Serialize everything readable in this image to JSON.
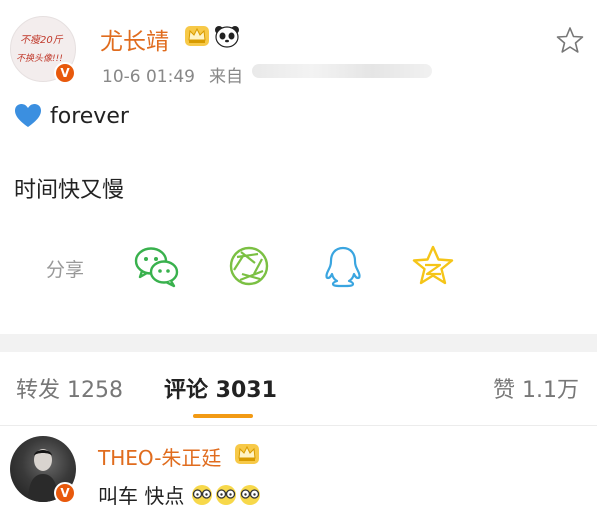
{
  "post": {
    "author": "尤长靖",
    "avatar_text_line1": "不瘦20斤",
    "avatar_text_line2": "不换头像!!!",
    "verified_badge": "V",
    "badges": [
      "crown-icon",
      "panda-icon"
    ],
    "time": "10-6 01:49",
    "source_prefix": "来自",
    "line1_emoji": "blue-heart-icon",
    "line1_text": "forever",
    "line2_text": "时间快又慢",
    "share_label": "分享",
    "share_targets": [
      "wechat-icon",
      "moments-icon",
      "qq-icon",
      "qzone-icon"
    ]
  },
  "tabs": {
    "repost": "转发 1258",
    "comment": "评论 3031",
    "like": "赞 1.1万"
  },
  "comment": {
    "author": "THEO-朱正廷",
    "verified_badge": "V",
    "badge": "crown-icon",
    "text": "叫车 快点",
    "emojis": [
      "glasses-face-icon",
      "glasses-face-icon",
      "glasses-face-icon"
    ]
  },
  "colors": {
    "name": "#e06c1e",
    "accent_underline": "#f29a14",
    "wechat": "#39b14d",
    "moments": "#7bc043",
    "qq": "#3aa5e0",
    "qzone": "#f5c518"
  }
}
